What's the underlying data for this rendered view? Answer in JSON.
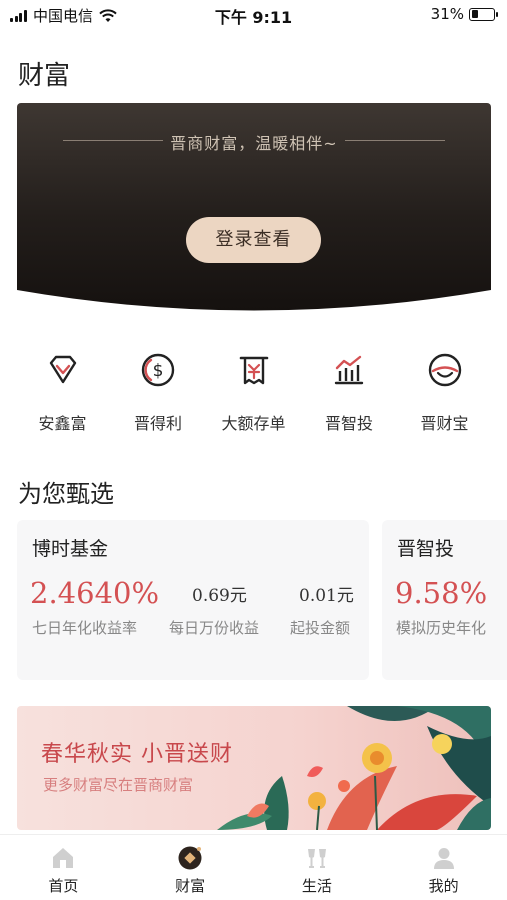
{
  "status_bar": {
    "carrier": "中国电信",
    "time": "下午 9:11",
    "battery": "31%",
    "battery_level": 0.31
  },
  "page_title": "财富",
  "hero": {
    "slogan": "晋商财富，温暖相伴~",
    "login_button": "登录查看"
  },
  "quick_entries": [
    {
      "label": "安鑫富",
      "icon": "diamond-icon"
    },
    {
      "label": "晋得利",
      "icon": "dollar-coin-icon"
    },
    {
      "label": "大额存单",
      "icon": "receipt-icon"
    },
    {
      "label": "晋智投",
      "icon": "bar-chart-icon"
    },
    {
      "label": "晋财宝",
      "icon": "treasure-icon"
    }
  ],
  "recommend": {
    "section_title": "为您甄选",
    "cards": [
      {
        "title": "博时基金",
        "rate": "2.4640%",
        "rate_label": "七日年化收益率",
        "per_10k": "0.69元",
        "per_10k_label": "每日万份收益",
        "min_invest": "0.01元",
        "min_invest_label": "起投金额"
      },
      {
        "title": "晋智投",
        "rate": "9.58%",
        "rate_label": "模拟历史年化"
      }
    ]
  },
  "banner": {
    "title": "春华秋实  小晋送财",
    "subtitle": "更多财富尽在晋商财富"
  },
  "tabbar": [
    {
      "label": "首页",
      "icon": "home-icon"
    },
    {
      "label": "财富",
      "icon": "wealth-coin-icon"
    },
    {
      "label": "生活",
      "icon": "cheers-icon"
    },
    {
      "label": "我的",
      "icon": "user-icon"
    }
  ],
  "colors": {
    "accent_red": "#d45153",
    "hero_dark": "#1e1a18",
    "login_button": "#ecd6c2",
    "card_bg": "#f7f7f8"
  }
}
